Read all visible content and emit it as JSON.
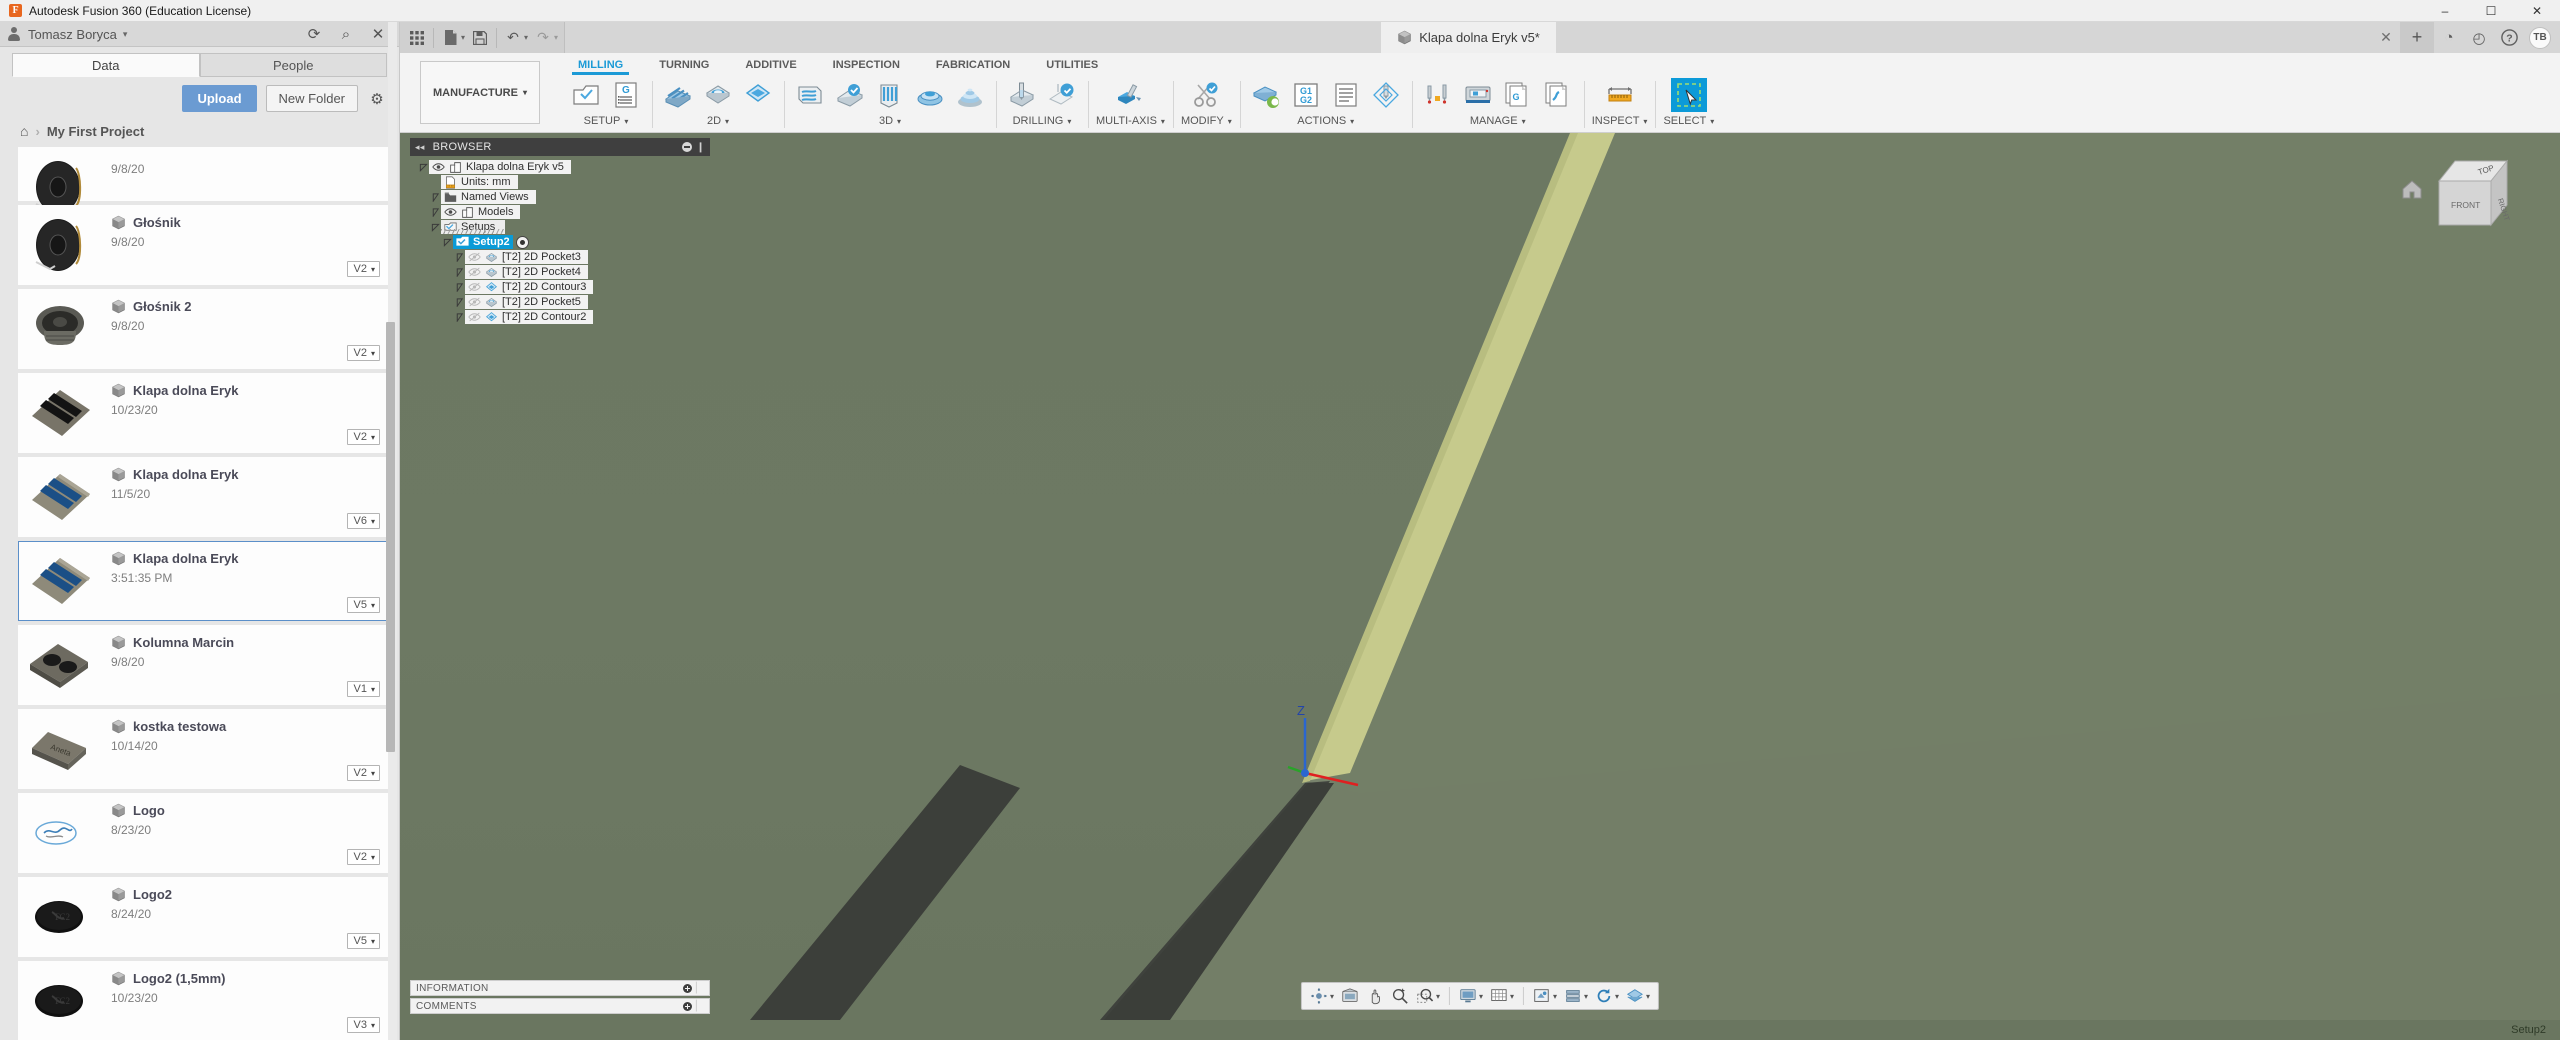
{
  "window": {
    "title": "Autodesk Fusion 360 (Education License)",
    "logo_letter": "F",
    "minimize": "–",
    "maximize": "☐",
    "close": "✕"
  },
  "data_panel": {
    "user_name": "Tomasz Boryca",
    "user_caret": "▾",
    "header_icons": [
      "refresh-icon",
      "search-icon",
      "close-icon"
    ],
    "refresh_glyph": "⟳",
    "search_glyph": "⌕",
    "close_glyph": "✕",
    "tabs": [
      {
        "label": "Data",
        "active": true
      },
      {
        "label": "People",
        "active": false
      }
    ],
    "upload_label": "Upload",
    "new_folder_label": "New Folder",
    "gear_glyph": "⚙",
    "breadcrumb": {
      "home_glyph": "⌂",
      "separator": "›",
      "project": "My First Project"
    },
    "items": [
      {
        "name": "",
        "date": "9/8/20",
        "version": "",
        "thumb": "speaker-cone",
        "partial": true,
        "selected": false
      },
      {
        "name": "Głośnik",
        "date": "9/8/20",
        "version": "V2",
        "thumb": "speaker-cone",
        "selected": false
      },
      {
        "name": "Głośnik 2",
        "date": "9/8/20",
        "version": "V2",
        "thumb": "speaker-driver",
        "selected": false
      },
      {
        "name": "Klapa dolna Eryk",
        "date": "10/23/20",
        "version": "V2",
        "thumb": "plate-dark",
        "selected": false
      },
      {
        "name": "Klapa dolna Eryk",
        "date": "11/5/20",
        "version": "V6",
        "thumb": "plate-blue",
        "selected": false
      },
      {
        "name": "Klapa dolna Eryk",
        "date": "3:51:35 PM",
        "version": "V5",
        "thumb": "plate-blue",
        "selected": true
      },
      {
        "name": "Kolumna Marcin",
        "date": "9/8/20",
        "version": "V1",
        "thumb": "box-speakers",
        "selected": false
      },
      {
        "name": "kostka testowa",
        "date": "10/14/20",
        "version": "V2",
        "thumb": "test-block",
        "selected": false
      },
      {
        "name": "Logo",
        "date": "8/23/20",
        "version": "V2",
        "thumb": "logo-sketch",
        "selected": false
      },
      {
        "name": "Logo2",
        "date": "8/24/20",
        "version": "V5",
        "thumb": "logo-disc",
        "selected": false
      },
      {
        "name": "Logo2 (1,5mm)",
        "date": "10/23/20",
        "version": "V3",
        "thumb": "logo-disc",
        "selected": false
      }
    ],
    "version_caret": "▾"
  },
  "quick_access": {
    "grid_glyph": "☷",
    "file_label": "file-icon",
    "save_label": "save-icon",
    "undo_glyph": "↶",
    "redo_glyph": "↷",
    "caret": "▾"
  },
  "document_tab": {
    "title": "Klapa dolna Eryk v5*",
    "close_glyph": "✕",
    "plus_glyph": "+",
    "right_icons": [
      "gauge-icon",
      "clock-icon",
      "help-icon"
    ],
    "gauge_glyph": "◔",
    "clock_glyph": "◴",
    "help_glyph": "?",
    "avatar_initials": "TB"
  },
  "ribbon": {
    "workspace": "MANUFACTURE",
    "workspace_caret": "▾",
    "tabs": [
      {
        "label": "MILLING",
        "active": true
      },
      {
        "label": "TURNING",
        "active": false
      },
      {
        "label": "ADDITIVE",
        "active": false
      },
      {
        "label": "INSPECTION",
        "active": false
      },
      {
        "label": "FABRICATION",
        "active": false
      },
      {
        "label": "UTILITIES",
        "active": false
      }
    ],
    "panels": [
      {
        "label": "SETUP",
        "dropdown": true,
        "icons": [
          "setup-icon",
          "g-code-list-icon"
        ]
      },
      {
        "label": "2D",
        "dropdown": true,
        "icons": [
          "face-icon",
          "2d-pocket-icon",
          "2d-contour-icon"
        ]
      },
      {
        "label": "3D",
        "dropdown": true,
        "icons": [
          "adaptive-clearing-icon",
          "pocket-clearing-icon",
          "parallel-icon",
          "scallop-icon",
          "spiral-icon"
        ]
      },
      {
        "label": "DRILLING",
        "dropdown": true,
        "icons": [
          "drill-icon",
          "drill-probe-icon"
        ]
      },
      {
        "label": "MULTI-AXIS",
        "dropdown": true,
        "icons": [
          "swarf-icon"
        ]
      },
      {
        "label": "MODIFY",
        "dropdown": true,
        "icons": [
          "trim-icon"
        ]
      },
      {
        "label": "ACTIONS",
        "dropdown": true,
        "icons": [
          "simulate-icon",
          "post-process-icon",
          "setup-sheet-icon",
          "probe-wcs-icon"
        ]
      },
      {
        "label": "MANAGE",
        "dropdown": true,
        "icons": [
          "tool-library-icon",
          "machine-library-icon",
          "post-library-icon",
          "template-library-icon"
        ]
      },
      {
        "label": "INSPECT",
        "dropdown": true,
        "icons": [
          "measure-icon"
        ]
      },
      {
        "label": "SELECT",
        "dropdown": true,
        "icons": [
          "select-icon"
        ]
      }
    ]
  },
  "browser": {
    "title": "BROWSER",
    "collapse_glyph": "◂◂",
    "grip_glyph": "❙",
    "tree": [
      {
        "depth": 0,
        "label": "Klapa dolna Eryk v5",
        "arrow": "expanded",
        "eye": true,
        "icon": "body-icon",
        "selected": false
      },
      {
        "depth": 1,
        "label": "Units: mm",
        "arrow": "none",
        "eye": false,
        "icon": "units-icon",
        "selected": false
      },
      {
        "depth": 1,
        "label": "Named Views",
        "arrow": "collapsed",
        "eye": false,
        "icon": "folder-icon",
        "selected": false
      },
      {
        "depth": 1,
        "label": "Models",
        "arrow": "collapsed",
        "eye": true,
        "icon": "body-icon",
        "selected": false
      },
      {
        "depth": 1,
        "label": "Setups",
        "arrow": "expanded",
        "eye": false,
        "icon": "setups-icon",
        "selected": false,
        "hatched": true
      },
      {
        "depth": 2,
        "label": "Setup2",
        "arrow": "expanded",
        "eye": false,
        "icon": "setup-folder-icon",
        "selected": true,
        "active_mark": true
      },
      {
        "depth": 3,
        "label": "[T2] 2D Pocket3",
        "arrow": "collapsed",
        "eye": "off",
        "icon": "pocket-op-icon",
        "selected": false
      },
      {
        "depth": 3,
        "label": "[T2] 2D Pocket4",
        "arrow": "collapsed",
        "eye": "off",
        "icon": "pocket-op-icon",
        "selected": false
      },
      {
        "depth": 3,
        "label": "[T2] 2D Contour3",
        "arrow": "collapsed",
        "eye": "off",
        "icon": "contour-op-icon",
        "selected": false
      },
      {
        "depth": 3,
        "label": "[T2] 2D Pocket5",
        "arrow": "collapsed",
        "eye": "off",
        "icon": "pocket-op-icon",
        "selected": false
      },
      {
        "depth": 3,
        "label": "[T2] 2D Contour2",
        "arrow": "collapsed",
        "eye": "off",
        "icon": "contour-op-icon",
        "selected": false
      }
    ]
  },
  "dock_panels": [
    {
      "label": "INFORMATION"
    },
    {
      "label": "COMMENTS"
    }
  ],
  "view_cube": {
    "top_label": "TOP",
    "front_label": "FRONT",
    "right_label": "RIGHT",
    "home_glyph": "⌂"
  },
  "origin_axes": {
    "z_label": "Z",
    "x_color": "#e02020",
    "y_color": "#29a329",
    "z_color": "#2a66d0"
  },
  "nav_bar": {
    "buttons": [
      {
        "name": "orbit-icon",
        "caret": true
      },
      {
        "name": "look-at-icon",
        "caret": false
      },
      {
        "name": "pan-icon",
        "caret": false
      },
      {
        "name": "zoom-icon",
        "caret": false
      },
      {
        "name": "zoom-window-icon",
        "caret": true
      },
      {
        "name": "display-settings-icon",
        "caret": true
      },
      {
        "name": "grid-snap-icon",
        "caret": true
      },
      {
        "name": "viewports-icon",
        "caret": true
      },
      {
        "name": "section-icon",
        "caret": true
      },
      {
        "name": "refresh-view-icon",
        "caret": true
      },
      {
        "name": "object-visibility-icon",
        "caret": true
      }
    ],
    "caret": "▾"
  },
  "status_bar": {
    "right_text": "Setup2"
  },
  "colors": {
    "accent_blue": "#1b9ad6",
    "selection_blue": "#0a9bd7",
    "upload_blue": "#6b9bd2",
    "canvas_green": "#6e7a63",
    "part_green": "#7d8a6f",
    "part_edge_yellow": "#c5c98a",
    "part_side_dark": "#474b45",
    "ribbon_bg": "#f3f3f3"
  }
}
